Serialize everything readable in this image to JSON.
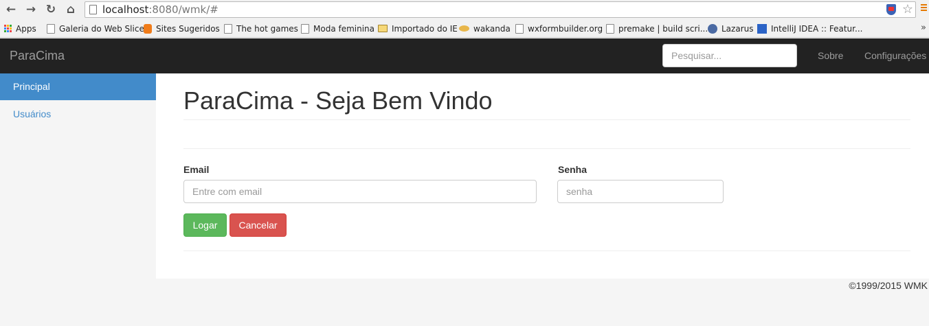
{
  "browser": {
    "url_host": "localhost",
    "url_rest": ":8080/wmk/#",
    "bookmarks": [
      {
        "label": "Apps",
        "icon": "apps-grid-icon"
      },
      {
        "label": "Galeria do Web Slice",
        "icon": "page-icon"
      },
      {
        "label": "Sites Sugeridos",
        "icon": "bulb-icon"
      },
      {
        "label": "The hot games",
        "icon": "page-icon"
      },
      {
        "label": "Moda feminina",
        "icon": "page-icon"
      },
      {
        "label": "Importado do IE",
        "icon": "folder-icon"
      },
      {
        "label": "wakanda",
        "icon": "handshake-icon"
      },
      {
        "label": "wxformbuilder.org",
        "icon": "page-icon"
      },
      {
        "label": "premake | build scri...",
        "icon": "page-icon"
      },
      {
        "label": "Lazarus",
        "icon": "gear-icon"
      },
      {
        "label": "IntelliJ IDEA :: Featur...",
        "icon": "intellij-icon"
      }
    ],
    "more": "»"
  },
  "navbar": {
    "brand": "ParaCima",
    "search_placeholder": "Pesquisar...",
    "links": [
      "Sobre",
      "Configurações"
    ]
  },
  "sidebar": {
    "items": [
      {
        "label": "Principal",
        "active": true
      },
      {
        "label": "Usuários",
        "active": false
      }
    ]
  },
  "main": {
    "title": "ParaCima - Seja Bem Vindo",
    "form": {
      "email_label": "Email",
      "email_placeholder": "Entre com email",
      "password_label": "Senha",
      "password_placeholder": "senha",
      "login_button": "Logar",
      "cancel_button": "Cancelar"
    }
  },
  "footer": {
    "text": "©1999/2015 WMK"
  },
  "colors": {
    "navbar_bg": "#222222",
    "sidebar_active": "#428bca",
    "success": "#5cb85c",
    "danger": "#d9534f"
  }
}
